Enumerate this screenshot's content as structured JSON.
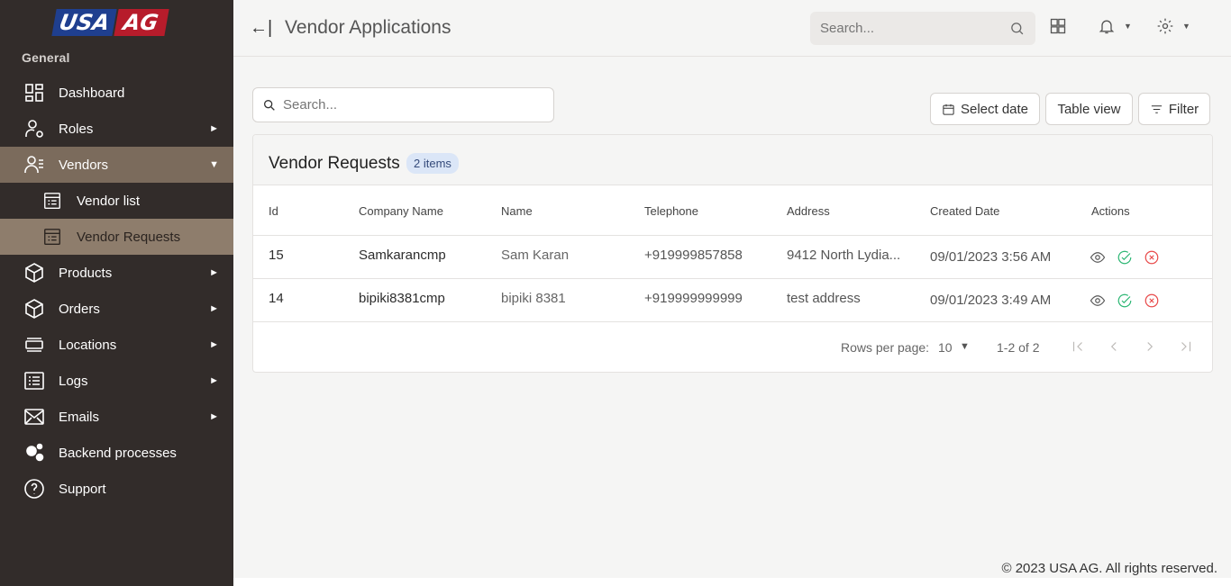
{
  "brand": {
    "logo_left": "USA",
    "logo_right": "AG",
    "colors": {
      "sidebar": "#322c2a",
      "active": "#8e7d6c",
      "logo_blue": "#1f3f8f",
      "logo_red": "#b71c2b"
    }
  },
  "sidebar": {
    "section": "General",
    "items": [
      {
        "label": "Dashboard",
        "icon": "dashboard-icon"
      },
      {
        "label": "Roles",
        "icon": "user-gear-icon"
      },
      {
        "label": "Vendors",
        "icon": "vendor-icon"
      },
      {
        "label": "Products",
        "icon": "box-icon"
      },
      {
        "label": "Orders",
        "icon": "box-icon"
      },
      {
        "label": "Locations",
        "icon": "location-stack-icon"
      },
      {
        "label": "Logs",
        "icon": "list-icon"
      },
      {
        "label": "Emails",
        "icon": "envelope-icon"
      },
      {
        "label": "Backend processes",
        "icon": "gears-icon"
      },
      {
        "label": "Support",
        "icon": "help-icon"
      }
    ],
    "vendor_sub": [
      {
        "label": "Vendor list",
        "icon": "list-doc-icon"
      },
      {
        "label": "Vendor Requests",
        "icon": "list-doc-icon"
      }
    ]
  },
  "header": {
    "title": "Vendor Applications",
    "search_placeholder": "Search..."
  },
  "toolbar": {
    "search_placeholder": "Search...",
    "select_date": "Select date",
    "table_view": "Table view",
    "filter": "Filter"
  },
  "table": {
    "title": "Vendor Requests",
    "count_badge": "2 items",
    "columns": [
      "Id",
      "Company Name",
      "Name",
      "Telephone",
      "Address",
      "Created Date",
      "Actions"
    ],
    "rows": [
      {
        "id": "15",
        "company": "Samkarancmp",
        "name": "Sam Karan",
        "telephone": "+919999857858",
        "address": "9412 North Lydia...",
        "created": "09/01/2023 3:56 AM"
      },
      {
        "id": "14",
        "company": "bipiki8381cmp",
        "name": "bipiki 8381",
        "telephone": "+919999999999",
        "address": "test address",
        "created": "09/01/2023 3:49 AM"
      }
    ],
    "pagination": {
      "rows_label": "Rows per page:",
      "rows_value": "10",
      "range": "1-2 of 2"
    }
  },
  "footer": "© 2023 USA AG. All rights reserved."
}
